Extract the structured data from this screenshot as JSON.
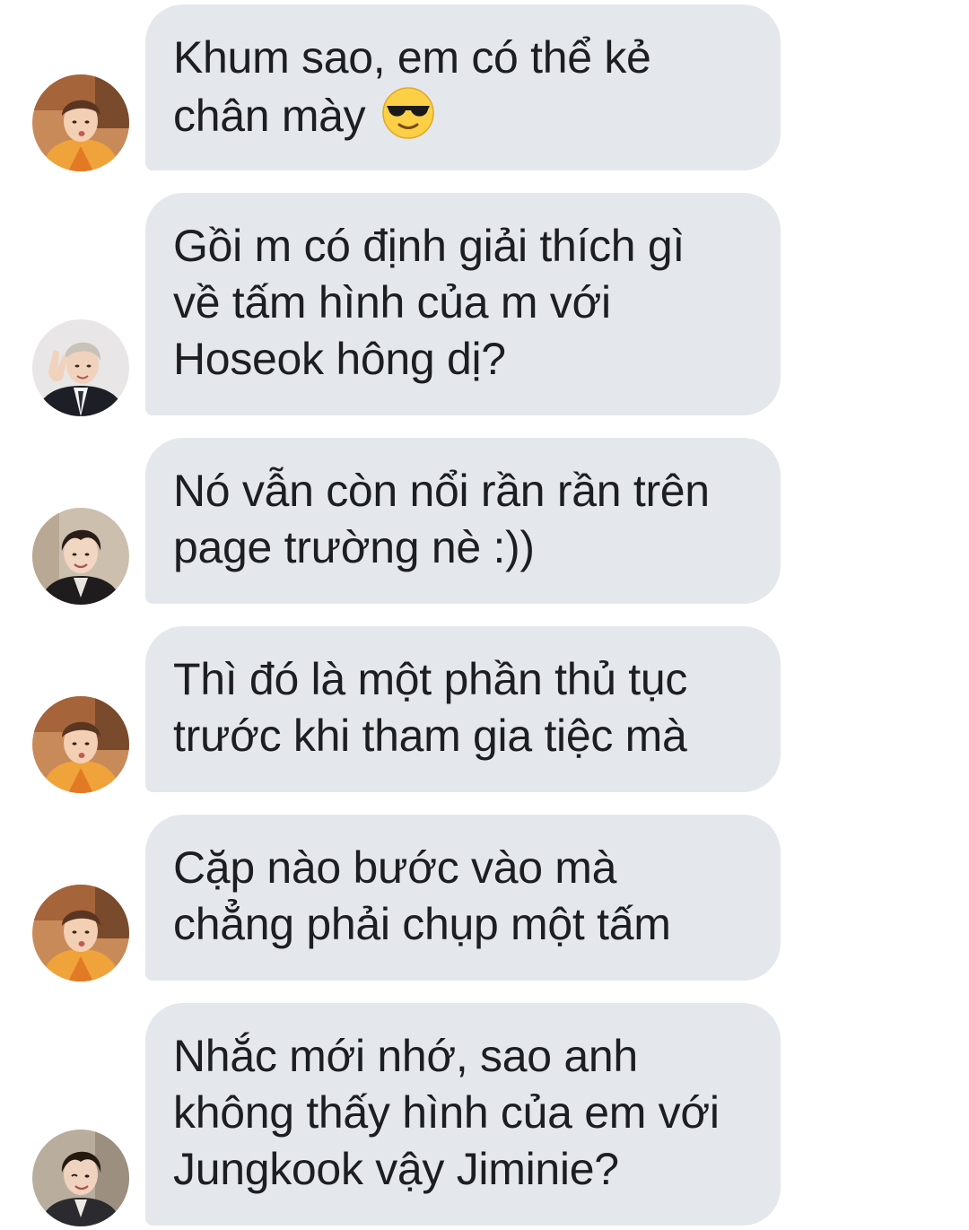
{
  "messages": [
    {
      "text": "Khum sao, em có thể kẻ\nchân mày ",
      "emoji": "sunglasses-emoji",
      "avatar": "avatar-orange-shirt"
    },
    {
      "text": "Gồi m có định giải thích gì\nvề tấm hình của m với\nHoseok hông dị?",
      "avatar": "avatar-silver-hair-suit"
    },
    {
      "text": "Nó vẫn còn nổi rần rần trên\npage trường nè :))",
      "avatar": "avatar-dark-hair-suit"
    },
    {
      "text": "Thì đó là một phần thủ tục\ntrước khi tham gia tiệc mà",
      "avatar": "avatar-orange-shirt"
    },
    {
      "text": "Cặp nào bước vào mà\nchẳng phải chụp một tấm",
      "avatar": "avatar-orange-shirt"
    },
    {
      "text": "Nhắc mới nhớ, sao anh\nkhông thấy hình của em với\nJungkook vậy Jiminie?",
      "avatar": "avatar-dark-hair-wink"
    }
  ],
  "colors": {
    "bubble_bg": "#e4e8ed",
    "text": "#1c1e21",
    "page_bg": "#ffffff"
  }
}
